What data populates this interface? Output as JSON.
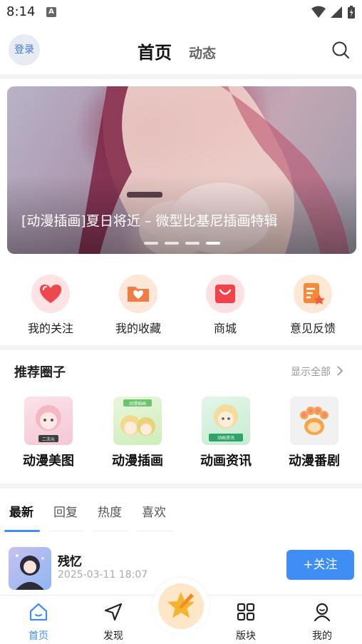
{
  "status_bar": {
    "time": "8:14",
    "a_label": "A"
  },
  "header": {
    "login_label": "登录",
    "tabs": [
      {
        "label": "首页"
      },
      {
        "label": "动态"
      }
    ]
  },
  "banner": {
    "title": "[动漫插画]夏日将近 – 微型比基尼插画特辑",
    "slide_count": 4,
    "active_slide": 4
  },
  "quick_actions": [
    {
      "label": "我的关注",
      "icon": "heart-icon",
      "color": "#f0474f",
      "bg": "#fde3e3"
    },
    {
      "label": "我的收藏",
      "icon": "folder-heart-icon",
      "color": "#f27c43",
      "bg": "#fde7d8"
    },
    {
      "label": "商城",
      "icon": "shopping-bag-icon",
      "color": "#f2424c",
      "bg": "#fde1e2"
    },
    {
      "label": "意见反馈",
      "icon": "feedback-doc-icon",
      "color": "#f28a3a",
      "bg": "#fde8d6"
    }
  ],
  "recommended": {
    "title": "推荐圈子",
    "show_all": "显示全部",
    "items": [
      {
        "label": "动漫美图",
        "thumb_badge": "二次元"
      },
      {
        "label": "动漫插画",
        "thumb_badge": "动漫插画"
      },
      {
        "label": "动画资讯",
        "thumb_badge": "动画资讯"
      },
      {
        "label": "动漫番剧",
        "thumb_badge": ""
      }
    ]
  },
  "feed_tabs": [
    {
      "label": "最新",
      "active": true
    },
    {
      "label": "回复",
      "active": false
    },
    {
      "label": "热度",
      "active": false
    },
    {
      "label": "喜欢",
      "active": false
    }
  ],
  "post": {
    "author": "残忆",
    "time": "2025-03-11 18:07",
    "follow_label": "+关注"
  },
  "bottom_nav": [
    {
      "label": "首页",
      "icon": "home-icon",
      "active": true
    },
    {
      "label": "发现",
      "icon": "discover-icon",
      "active": false
    },
    {
      "label": "版块",
      "icon": "grid-icon",
      "active": false
    },
    {
      "label": "我的",
      "icon": "profile-icon",
      "active": false
    }
  ],
  "colors": {
    "accent": "#3f8ef5",
    "divider": "#f3f4f6"
  }
}
